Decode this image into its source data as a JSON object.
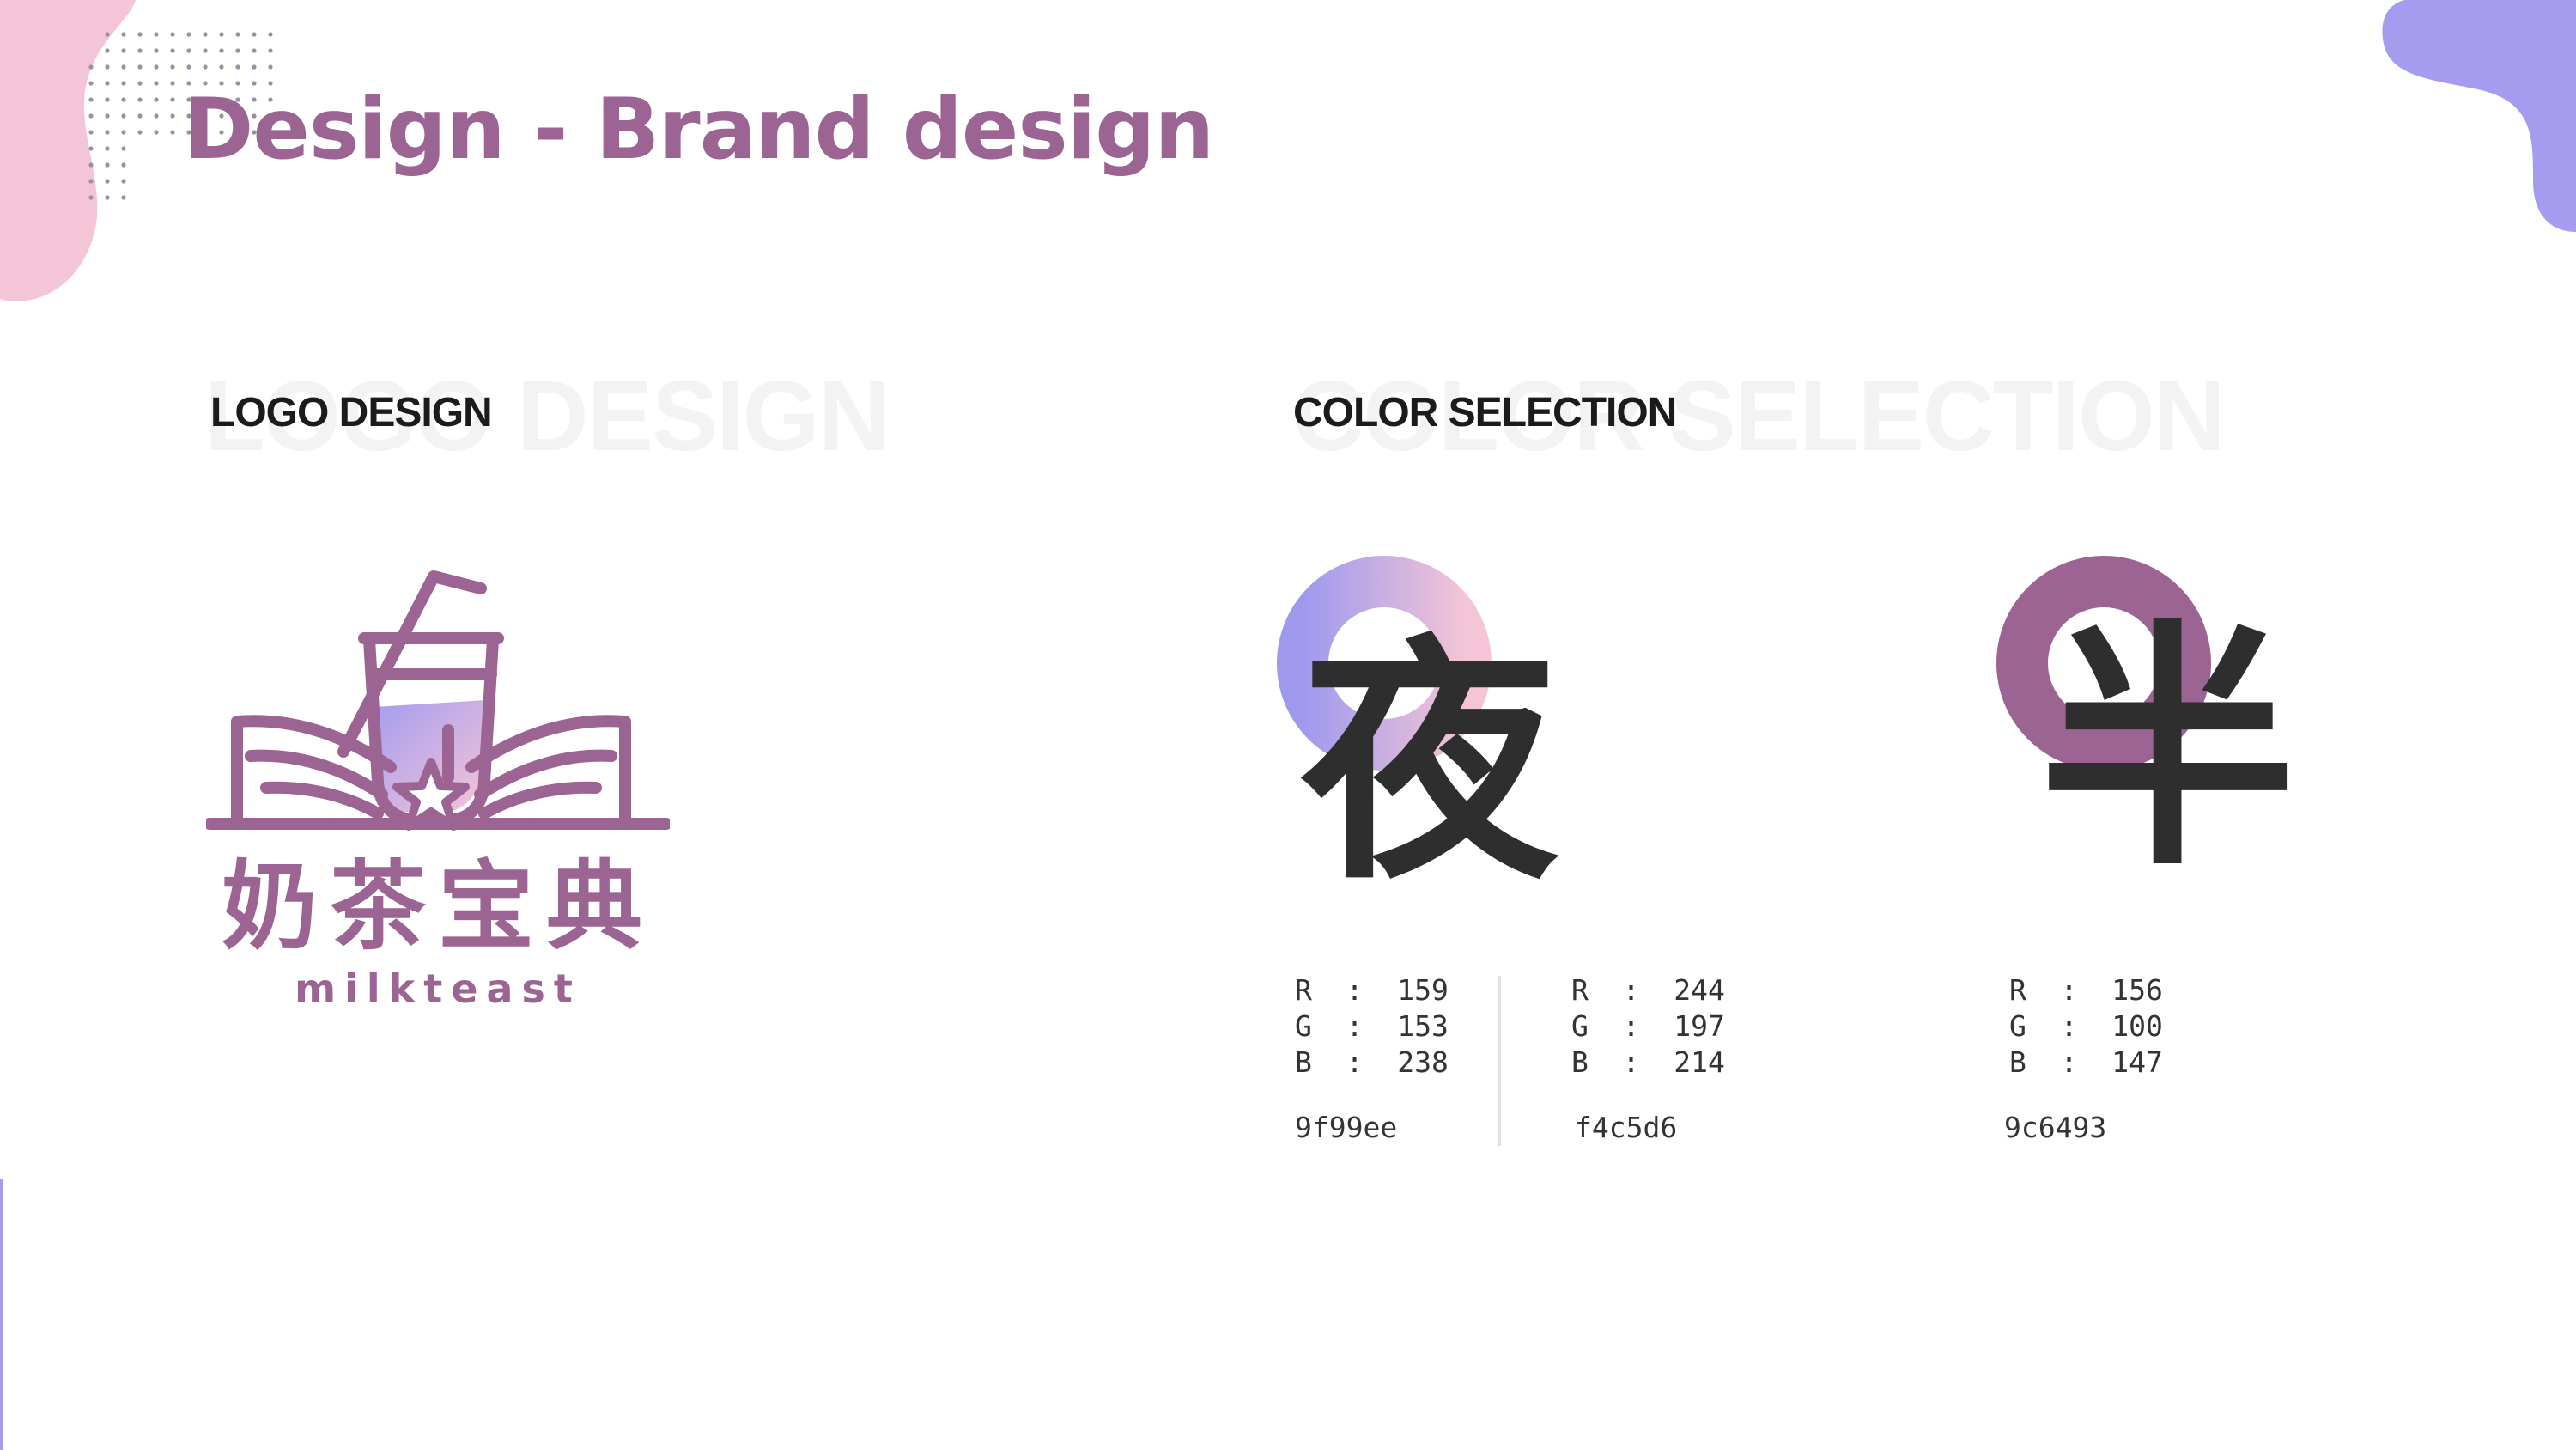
{
  "title": "Design - Brand design",
  "sections": {
    "logo": {
      "heading": "LOGO DESIGN",
      "ghost": "LOGO DESIGN"
    },
    "color": {
      "heading": "COLOR SELECTION",
      "ghost": "COLOR SELECTION"
    }
  },
  "logo": {
    "name_cn": "奶茶宝典",
    "name_en": "milkteast"
  },
  "swatches": [
    {
      "r": "159",
      "g": "153",
      "b": "238",
      "hex": "9f99ee"
    },
    {
      "r": "244",
      "g": "197",
      "b": "214",
      "hex": "f4c5d6"
    },
    {
      "r": "156",
      "g": "100",
      "b": "147",
      "hex": "9c6493"
    }
  ],
  "glyphs": [
    "夜",
    "半"
  ],
  "colors": {
    "brand_purple": "#9c6493",
    "lavender": "#9f99ee",
    "pink": "#f4c5d6",
    "blob_pink": "#f4c5d6",
    "blob_purple": "#a59cf0"
  }
}
